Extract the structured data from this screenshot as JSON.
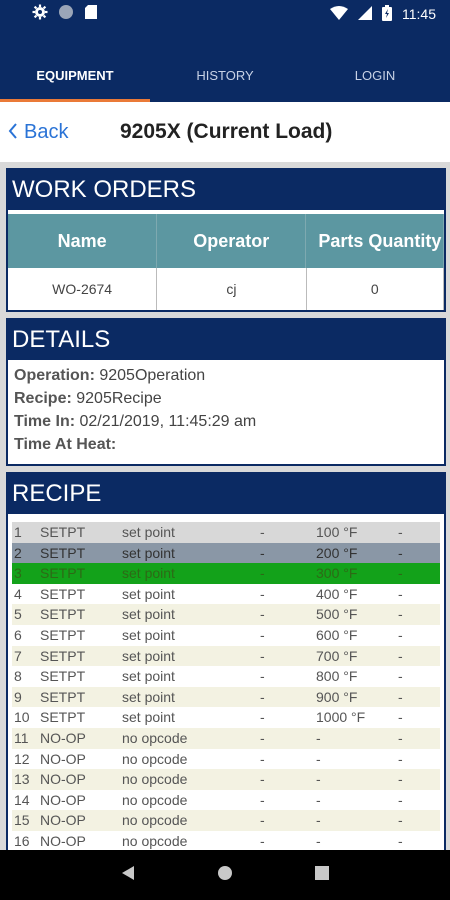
{
  "status_bar": {
    "time": "11:45",
    "icons_left": [
      "gear-icon",
      "circle-icon",
      "sd-card-icon"
    ],
    "icons_right": [
      "wifi-icon",
      "signal-icon",
      "battery-icon"
    ]
  },
  "tabs": [
    {
      "label": "EQUIPMENT",
      "active": true
    },
    {
      "label": "HISTORY",
      "active": false
    },
    {
      "label": "LOGIN",
      "active": false
    }
  ],
  "header": {
    "back_label": "Back",
    "title": "9205X (Current Load)"
  },
  "work_orders": {
    "title": "WORK ORDERS",
    "columns": [
      "Name",
      "Operator",
      "Parts Quantity"
    ],
    "rows": [
      [
        "WO-2674",
        "cj",
        "0"
      ]
    ]
  },
  "details": {
    "title": "DETAILS",
    "fields": [
      {
        "label": "Operation:",
        "value": "9205Operation"
      },
      {
        "label": "Recipe:",
        "value": "9205Recipe"
      },
      {
        "label": "Time In:",
        "value": "02/21/2019, 11:45:29 am"
      },
      {
        "label": "Time At Heat:",
        "value": ""
      }
    ]
  },
  "recipe": {
    "title": "RECIPE",
    "rows": [
      {
        "num": "1",
        "op": "SETPT",
        "desc": "set point",
        "d1": "-",
        "val": "100 °F",
        "d2": "-"
      },
      {
        "num": "2",
        "op": "SETPT",
        "desc": "set point",
        "d1": "-",
        "val": "200 °F",
        "d2": "-"
      },
      {
        "num": "3",
        "op": "SETPT",
        "desc": "set point",
        "d1": "-",
        "val": "300 °F",
        "d2": "-"
      },
      {
        "num": "4",
        "op": "SETPT",
        "desc": "set point",
        "d1": "-",
        "val": "400 °F",
        "d2": "-"
      },
      {
        "num": "5",
        "op": "SETPT",
        "desc": "set point",
        "d1": "-",
        "val": "500 °F",
        "d2": "-"
      },
      {
        "num": "6",
        "op": "SETPT",
        "desc": "set point",
        "d1": "-",
        "val": "600 °F",
        "d2": "-"
      },
      {
        "num": "7",
        "op": "SETPT",
        "desc": "set point",
        "d1": "-",
        "val": "700 °F",
        "d2": "-"
      },
      {
        "num": "8",
        "op": "SETPT",
        "desc": "set point",
        "d1": "-",
        "val": "800 °F",
        "d2": "-"
      },
      {
        "num": "9",
        "op": "SETPT",
        "desc": "set point",
        "d1": "-",
        "val": "900 °F",
        "d2": "-"
      },
      {
        "num": "10",
        "op": "SETPT",
        "desc": "set point",
        "d1": "-",
        "val": "1000 °F",
        "d2": "-"
      },
      {
        "num": "11",
        "op": "NO-OP",
        "desc": "no opcode",
        "d1": "-",
        "val": "-",
        "d2": "-"
      },
      {
        "num": "12",
        "op": "NO-OP",
        "desc": "no opcode",
        "d1": "-",
        "val": "-",
        "d2": "-"
      },
      {
        "num": "13",
        "op": "NO-OP",
        "desc": "no opcode",
        "d1": "-",
        "val": "-",
        "d2": "-"
      },
      {
        "num": "14",
        "op": "NO-OP",
        "desc": "no opcode",
        "d1": "-",
        "val": "-",
        "d2": "-"
      },
      {
        "num": "15",
        "op": "NO-OP",
        "desc": "no opcode",
        "d1": "-",
        "val": "-",
        "d2": "-"
      },
      {
        "num": "16",
        "op": "NO-OP",
        "desc": "no opcode",
        "d1": "-",
        "val": "-",
        "d2": "-"
      }
    ]
  },
  "nav_bar": {
    "buttons": [
      "back-nav-icon",
      "home-nav-icon",
      "recents-nav-icon"
    ]
  },
  "colors": {
    "primary": "#0b2a63",
    "accent": "#ea7a38",
    "link": "#2a73d6",
    "table_header": "#5c97a1",
    "row_active": "#13a21a",
    "row_done": "#8a97a6"
  }
}
